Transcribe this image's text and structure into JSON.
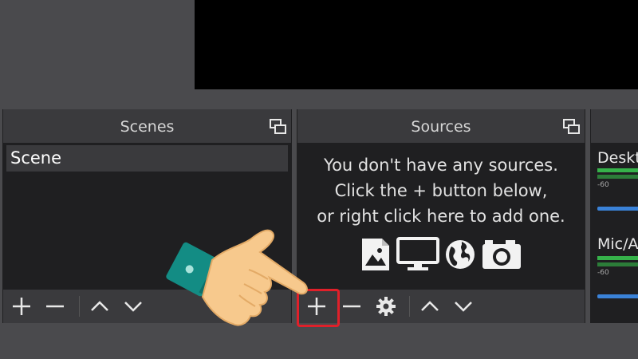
{
  "scenes": {
    "title": "Scenes",
    "items": [
      "Scene"
    ]
  },
  "sources": {
    "title": "Sources",
    "empty_lines": [
      "You don't have any sources.",
      "Click the + button below,",
      "or right click here to add one."
    ]
  },
  "mixer": {
    "channels": [
      {
        "label": "Deskt",
        "tick": "-60"
      },
      {
        "label": "Mic/A",
        "tick": "-60"
      }
    ]
  },
  "icons": {
    "float": "float-dock-icon",
    "add": "plus-icon",
    "remove": "minus-icon",
    "up": "chevron-up-icon",
    "down": "chevron-down-icon",
    "settings": "gear-icon",
    "source_types": [
      "image-icon",
      "monitor-icon",
      "globe-icon",
      "camera-icon"
    ],
    "pointer": "pointing-hand-icon"
  },
  "colors": {
    "highlight": "#e0202a",
    "meter_green": "#36b24a",
    "volume_blue": "#3a82d8"
  }
}
